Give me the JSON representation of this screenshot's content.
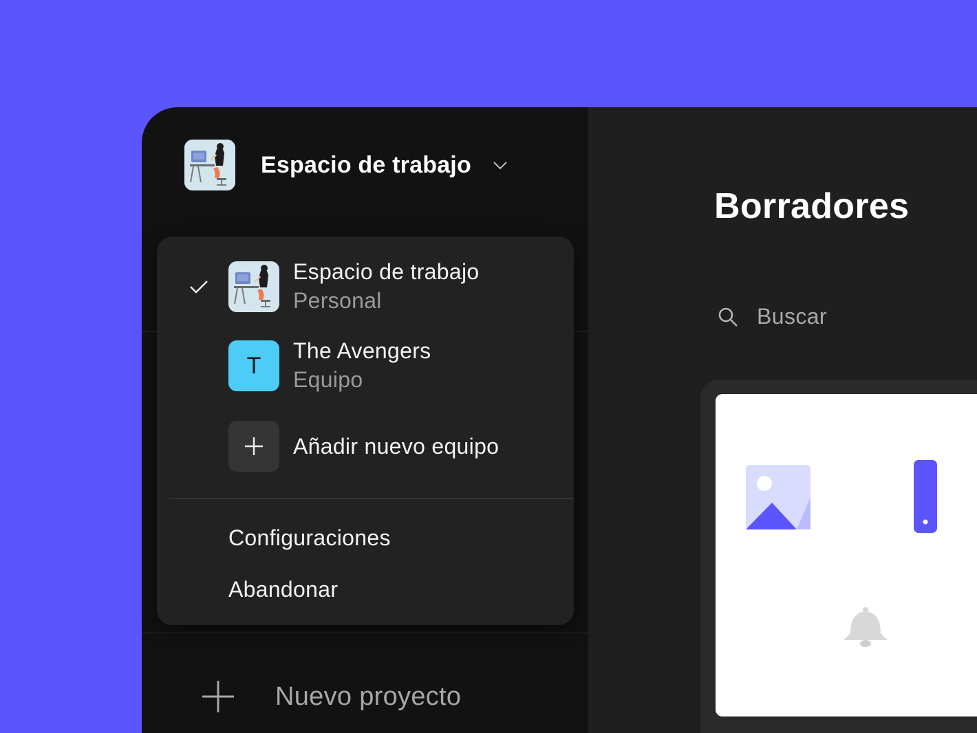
{
  "workspace": {
    "title": "Espacio de trabajo",
    "avatar_icon": "person-at-desk-illustration"
  },
  "dropdown": {
    "items": [
      {
        "name": "Espacio de trabajo",
        "subtitle": "Personal",
        "selected": true
      },
      {
        "name": "The Avengers",
        "subtitle": "Equipo",
        "initial": "T",
        "color": "#4dccf7"
      }
    ],
    "add_label": "Añadir nuevo equipo",
    "settings_label": "Configuraciones",
    "leave_label": "Abandonar"
  },
  "sidebar": {
    "new_project_label": "Nuevo proyecto"
  },
  "main": {
    "title": "Borradores",
    "search_placeholder": "Buscar"
  },
  "colors": {
    "background": "#5b55fe",
    "accent": "#5b55fe",
    "sidebar": "#121212",
    "main": "#1f1f1f",
    "dropdown": "#222222"
  }
}
